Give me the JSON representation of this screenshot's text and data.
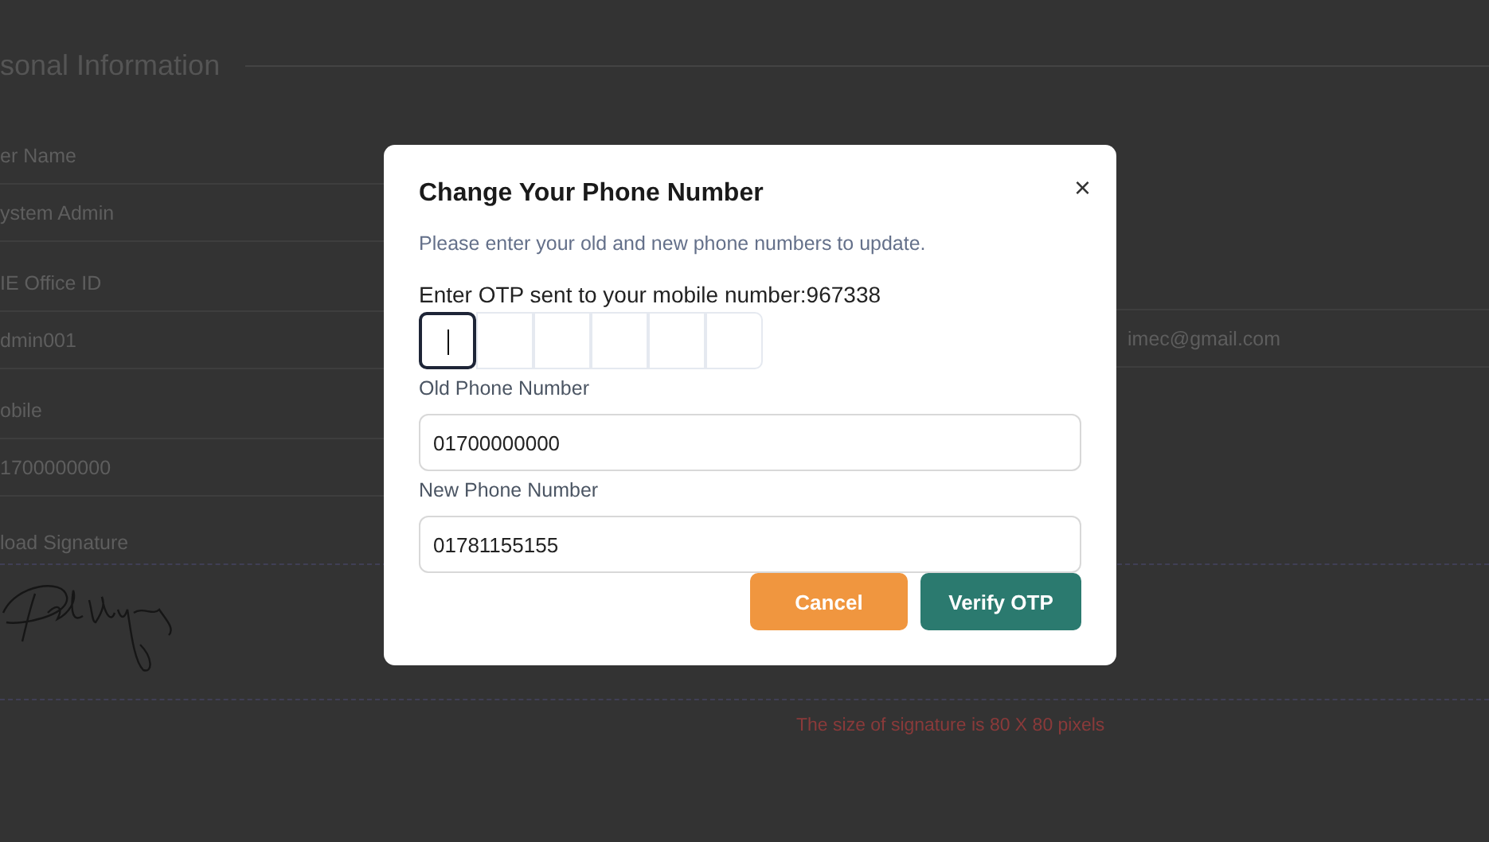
{
  "page": {
    "section_title": "sonal Information",
    "left_fields": [
      {
        "label": "er Name",
        "value": "ystem Admin"
      },
      {
        "label": "IE Office ID",
        "value": "dmin001"
      },
      {
        "label": "obile",
        "value": "1700000000"
      }
    ],
    "right_fields": [
      {
        "value": "imec@gmail.com"
      }
    ],
    "signature_label": "load Signature",
    "signature_note": "The size of signature is 80 X 80 pixels"
  },
  "dialog": {
    "title": "Change Your Phone Number",
    "close": "×",
    "subtitle": "Please enter your old and new phone numbers to update.",
    "otp_label": "Enter OTP sent to your mobile number:967338",
    "otp_boxes": [
      {
        "focused": true
      },
      {
        "focused": false
      },
      {
        "focused": false
      },
      {
        "focused": false
      },
      {
        "focused": false
      },
      {
        "focused": false
      }
    ],
    "fields": [
      {
        "label": "Old Phone Number",
        "value": "01700000000"
      },
      {
        "label": "New Phone Number",
        "value": "01781155155"
      }
    ],
    "buttons": [
      {
        "kind": "cancel",
        "label": "Cancel"
      },
      {
        "kind": "primary",
        "label": "Verify OTP"
      }
    ]
  }
}
